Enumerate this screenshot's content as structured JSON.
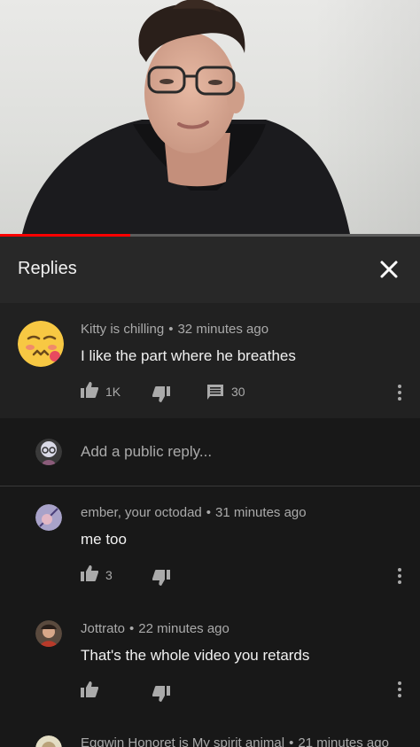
{
  "video": {
    "progress_percent": 31
  },
  "replies_panel": {
    "title": "Replies",
    "close_icon": "close-icon"
  },
  "parent_comment": {
    "author": "Kitty is chilling",
    "time": "32 minutes ago",
    "text": "I like the part where he breathes",
    "likes": "1K",
    "replies": "30"
  },
  "add_reply": {
    "placeholder": "Add a public reply..."
  },
  "replies": [
    {
      "author": "ember, your octodad",
      "time": "31 minutes ago",
      "text": "me too",
      "likes": "3"
    },
    {
      "author": "Jottrato",
      "time": "22 minutes ago",
      "text": "That's the whole video you retards",
      "likes": ""
    },
    {
      "author": "Eggwin Honoret is My spirit animal",
      "time": "21 minutes ago",
      "text": "",
      "likes": ""
    }
  ],
  "colors": {
    "accent": "#ff0000",
    "background": "#181818",
    "panel": "#282828",
    "parent_bg": "#212121"
  }
}
